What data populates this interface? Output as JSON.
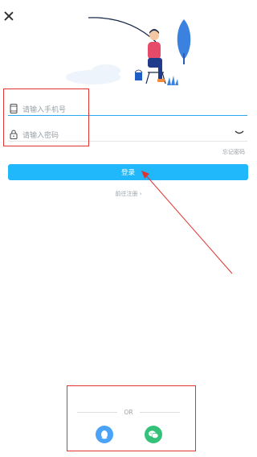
{
  "header": {
    "close_icon": "close-icon"
  },
  "form": {
    "phone_placeholder": "请输入手机号",
    "password_placeholder": "请输入密码",
    "forgot_label": "忘记密码",
    "login_label": "登录",
    "register_label": "前往注册 ›"
  },
  "social": {
    "divider_label": "OR",
    "providers": [
      {
        "name": "qq",
        "icon": "qq-icon",
        "color": "#4aa3f7"
      },
      {
        "name": "wechat",
        "icon": "wechat-icon",
        "color": "#34c27a"
      }
    ]
  },
  "colors": {
    "accent": "#21b7fb",
    "annotation": "#e0322f"
  }
}
